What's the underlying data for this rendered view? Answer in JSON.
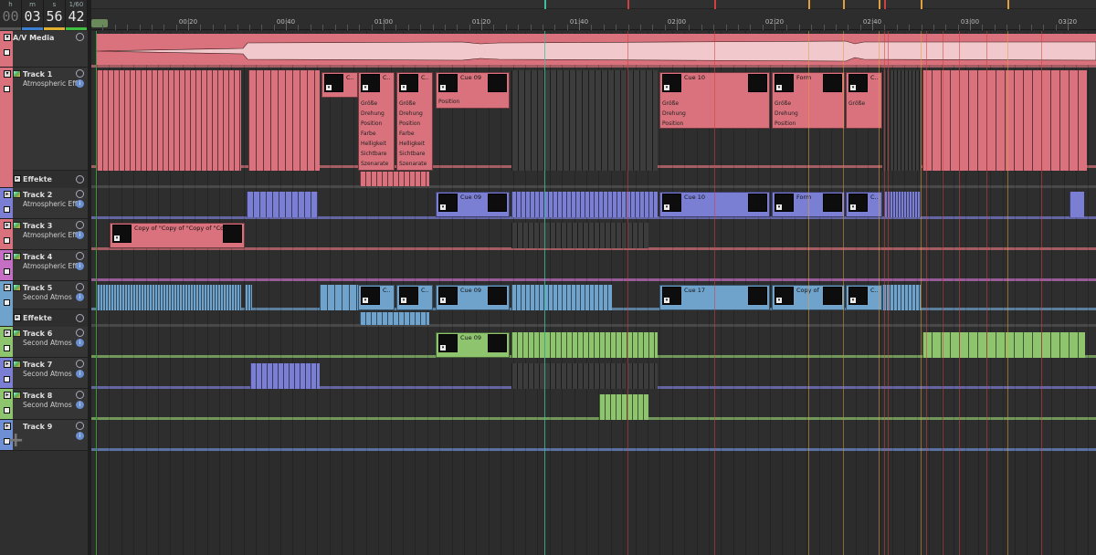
{
  "counter": {
    "h": {
      "label": "h",
      "value": "00"
    },
    "m": {
      "label": "m",
      "value": "03"
    },
    "s": {
      "label": "s",
      "value": "56"
    },
    "f": {
      "label": "1/60",
      "value": "42"
    }
  },
  "ruler": {
    "labels": [
      "00:20",
      "00:40",
      "01:00",
      "01:20",
      "01:40",
      "02:00",
      "02:20",
      "02:40",
      "03:00",
      "03:20"
    ]
  },
  "tracks": [
    {
      "name": "A/V Media",
      "sub": "",
      "color": "#d9727c"
    },
    {
      "name": "Track 1",
      "sub": "Atmospheric Effects",
      "color": "#d9727c"
    },
    {
      "name": "Track 2",
      "sub": "Atmospheric Effects",
      "color": "#7b7fd4"
    },
    {
      "name": "Track 3",
      "sub": "Atmospheric Effects",
      "color": "#d9727c"
    },
    {
      "name": "Track 4",
      "sub": "Atmospheric Effects",
      "color": "#c46fc4"
    },
    {
      "name": "Track 5",
      "sub": "Second Atmos",
      "color": "#6fa3cc"
    },
    {
      "name": "Track 6",
      "sub": "Second Atmos",
      "color": "#8fc46f"
    },
    {
      "name": "Track 7",
      "sub": "Second Atmos",
      "color": "#7b7fd4"
    },
    {
      "name": "Track 8",
      "sub": "Second Atmos",
      "color": "#8fc46f"
    },
    {
      "name": "Track 9",
      "sub": "",
      "color": "#6f8fd4"
    }
  ],
  "effekte_label": "Effekte",
  "add_label": "+",
  "clips": {
    "t1_c1": "C..",
    "t1_c2": "C..",
    "t1_c3": "C..",
    "t1_cue09": "Cue 09",
    "t1_cue10": "Cue 10",
    "t1_form": "Form",
    "t1_c4": "C..",
    "t2_cue09": "Cue 09",
    "t2_cue10": "Cue 10",
    "t2_form": "Form",
    "t2_c": "C..",
    "t3_copy": "Copy of \"Copy of \"Copy of \"Co",
    "t5_c1": "C..",
    "t5_c2": "C..",
    "t5_cue09": "Cue 09",
    "t5_cue17": "Cue 17",
    "t5_copy": "Copy of",
    "t5_c3": "C..",
    "t6_cue09": "Cue 09"
  },
  "props": {
    "list_a": [
      "Größe",
      "Drehung",
      "Position",
      "Farbe",
      "Helligkeit",
      "Sichtbare",
      "Szenarate"
    ],
    "list_b": [
      "Größe",
      "Drehung",
      "Position"
    ],
    "list_pos": "Position"
  },
  "colors": {
    "red": "#d9727c",
    "blue": "#7b7fd4",
    "lightblue": "#6fa3cc",
    "green": "#8fc46f",
    "purple": "#c46fc4",
    "playhead": "#3fbf9f",
    "marker_orange": "#e0a040"
  }
}
